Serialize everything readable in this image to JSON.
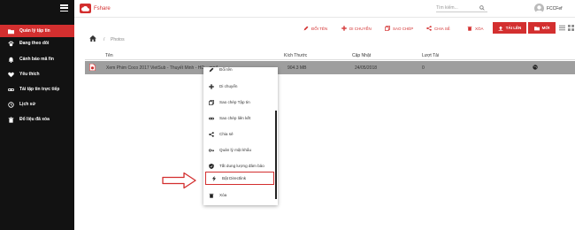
{
  "app": {
    "brand": "Fshare"
  },
  "sidebar": {
    "items": [
      {
        "label": "Quản lý tập tin",
        "icon": "folder-icon",
        "active": true
      },
      {
        "label": "Đang theo dõi",
        "icon": "paw-icon"
      },
      {
        "label": "Cảnh báo mã fin",
        "icon": "bell-icon"
      },
      {
        "label": "Yêu thích",
        "icon": "heart-icon"
      },
      {
        "label": "Tải tập tin trực tiếp",
        "icon": "link-icon"
      },
      {
        "label": "Lịch sử",
        "icon": "clock-icon"
      },
      {
        "label": "Đổ liệu đã xóa",
        "icon": "trash-icon"
      }
    ]
  },
  "header": {
    "search_placeholder": "Tìm kiếm...",
    "user_name": "FCCFef"
  },
  "toolbar": {
    "rename": "ĐỔI TÊN",
    "move": "DI CHUYỂN",
    "copy": "SAO CHÉP",
    "share": "CHIA SẺ",
    "delete": "XÓA",
    "upload": "TẢI LÊN",
    "new": "MỚI"
  },
  "breadcrumb": {
    "separator": "/",
    "current": "Photos"
  },
  "table": {
    "headers": {
      "name": "Tên",
      "size": "Kích Thước",
      "updated": "Cập Nhật",
      "downloads": "Lượt Tải"
    },
    "rows": [
      {
        "name": "Xem Phim Coco 2017 VietSub - Thuyết Minh - HD ...mp4",
        "size": "904.3 MB",
        "updated": "24/05/2018",
        "downloads": "0"
      }
    ]
  },
  "context_menu": {
    "items": [
      {
        "label": "Đổi tên",
        "icon": "pencil-icon"
      },
      {
        "label": "Di chuyển",
        "icon": "move-icon"
      },
      {
        "label": "Sao chép Tập tin",
        "icon": "copy-icon"
      },
      {
        "label": "Sao chép liên kết",
        "icon": "link-icon"
      },
      {
        "label": "Chia sẻ",
        "icon": "share-icon"
      },
      {
        "label": "Quản lý mật khẩu",
        "icon": "key-icon"
      },
      {
        "label": "Tắt dung lượng đảm bảo",
        "icon": "shield-icon"
      },
      {
        "label": "Bật Directlink",
        "icon": "lightning-icon",
        "highlighted": true
      },
      {
        "label": "Xóa",
        "icon": "trash-icon"
      }
    ]
  },
  "colors": {
    "accent": "#d32f2f",
    "sidebar_bg": "#121212",
    "selected_row": "#9e9e9e"
  }
}
